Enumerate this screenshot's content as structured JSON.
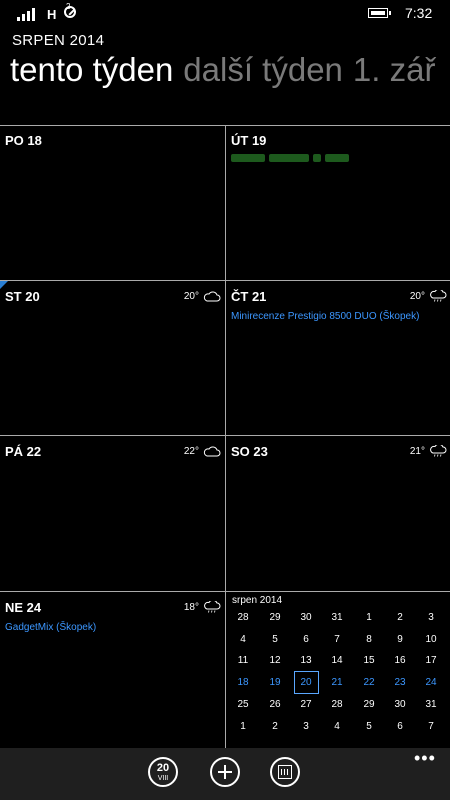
{
  "status": {
    "network": "H",
    "sim_sup": "2",
    "time": "7:32"
  },
  "header": {
    "month_title": "SRPEN 2014",
    "pivot": [
      "tento týden",
      "další týden",
      "1. zář"
    ]
  },
  "days": [
    {
      "label": "PO 18",
      "temp": "",
      "icon": "",
      "event": ""
    },
    {
      "label": "ÚT 19",
      "temp": "",
      "icon": "",
      "event": ""
    },
    {
      "label": "ST 20",
      "temp": "20°",
      "icon": "cloud-icon",
      "event": ""
    },
    {
      "label": "ČT 21",
      "temp": "20°",
      "icon": "cloud-rain-icon",
      "event": "Minirecenze Prestigio 8500 DUO (Škopek)"
    },
    {
      "label": "PÁ 22",
      "temp": "22°",
      "icon": "cloud-icon",
      "event": ""
    },
    {
      "label": "SO 23",
      "temp": "21°",
      "icon": "cloud-rain-icon",
      "event": ""
    },
    {
      "label": "NE 24",
      "temp": "18°",
      "icon": "cloud-rain-icon",
      "event": "GadgetMix (Škopek)"
    }
  ],
  "mini_calendar": {
    "title": "srpen 2014",
    "weeks": [
      [
        "28",
        "29",
        "30",
        "31",
        "1",
        "2",
        "3"
      ],
      [
        "4",
        "5",
        "6",
        "7",
        "8",
        "9",
        "10"
      ],
      [
        "11",
        "12",
        "13",
        "14",
        "15",
        "16",
        "17"
      ],
      [
        "18",
        "19",
        "20",
        "21",
        "22",
        "23",
        "24"
      ],
      [
        "25",
        "26",
        "27",
        "28",
        "29",
        "30",
        "31"
      ],
      [
        "1",
        "2",
        "3",
        "4",
        "5",
        "6",
        "7"
      ]
    ],
    "highlight_week": 3,
    "today": "20"
  },
  "appbar": {
    "today_day": "20",
    "today_month": "VIII",
    "more": "•••"
  },
  "colors": {
    "accent": "#3c97ff",
    "grid_line": "#aaaaaa",
    "appbar_bg": "#1f1f1f"
  }
}
